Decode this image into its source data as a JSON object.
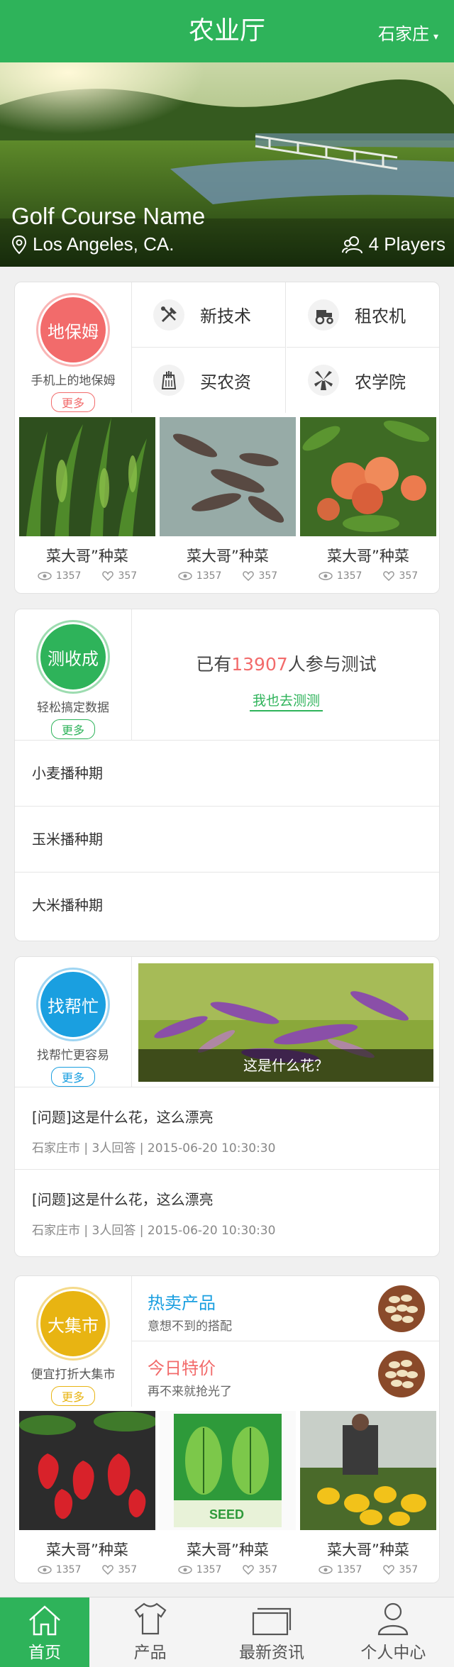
{
  "header": {
    "title": "农业厅",
    "city": "石家庄",
    "caret": "▾"
  },
  "hero": {
    "course_name": "Golf Course Name",
    "location": "Los Angeles, CA.",
    "players": "4 Players"
  },
  "section1": {
    "circle_label": "地保姆",
    "circle_sub": "手机上的地保姆",
    "more": "更多",
    "colors": {
      "circle": "#f26b6b",
      "more": "#f26b6b"
    },
    "grid": [
      {
        "label": "新技术",
        "icon": "tools-icon"
      },
      {
        "label": "租农机",
        "icon": "tractor-icon"
      },
      {
        "label": "买农资",
        "icon": "seed-bag-icon"
      },
      {
        "label": "农学院",
        "icon": "windmill-icon"
      }
    ],
    "photos": [
      {
        "caption": "菜大哥”种菜",
        "views": "1357",
        "likes": "357"
      },
      {
        "caption": "菜大哥”种菜",
        "views": "1357",
        "likes": "357"
      },
      {
        "caption": "菜大哥”种菜",
        "views": "1357",
        "likes": "357"
      }
    ]
  },
  "section2": {
    "circle_label": "测收成",
    "circle_sub": "轻松搞定数据",
    "more": "更多",
    "colors": {
      "circle": "#2eb35a",
      "more": "#2eb35a",
      "count": "#f26b6b"
    },
    "test_prefix": "已有",
    "test_count": "13907",
    "test_suffix": "人参与测试",
    "test_link": "我也去测测",
    "list": [
      "小麦播种期",
      "玉米播种期",
      "大米播种期"
    ]
  },
  "section3": {
    "circle_label": "找帮忙",
    "circle_sub": "找帮忙更容易",
    "more": "更多",
    "colors": {
      "circle": "#1a9fe0",
      "more": "#1a9fe0"
    },
    "photo_caption": "这是什么花？",
    "questions": [
      {
        "title": "[问题]这是什么花，这么漂亮",
        "meta": "石家庄市 | 3人回答 | 2015-06-20 10:30:30"
      },
      {
        "title": "[问题]这是什么花，这么漂亮",
        "meta": "石家庄市 | 3人回答 | 2015-06-20 10:30:30"
      }
    ]
  },
  "section4": {
    "circle_label": "大集市",
    "circle_sub": "便宜打折大集市",
    "more": "更多",
    "colors": {
      "circle": "#e8b412",
      "more": "#e8b412",
      "hot": "#1a9fe0",
      "today": "#f26b6b"
    },
    "promos": [
      {
        "title": "热卖产品",
        "sub": "意想不到的搭配"
      },
      {
        "title": "今日特价",
        "sub": "再不来就抢光了"
      }
    ],
    "photos": [
      {
        "caption": "菜大哥”种菜",
        "views": "1357",
        "likes": "357"
      },
      {
        "caption": "菜大哥”种菜",
        "views": "1357",
        "likes": "357"
      },
      {
        "caption": "菜大哥”种菜",
        "views": "1357",
        "likes": "357"
      }
    ]
  },
  "tabbar": [
    {
      "label": "首页",
      "icon": "home-icon",
      "active": true
    },
    {
      "label": "产品",
      "icon": "shirt-icon",
      "active": false
    },
    {
      "label": "最新资讯",
      "icon": "news-icon",
      "active": false
    },
    {
      "label": "个人中心",
      "icon": "user-icon",
      "active": false
    }
  ]
}
